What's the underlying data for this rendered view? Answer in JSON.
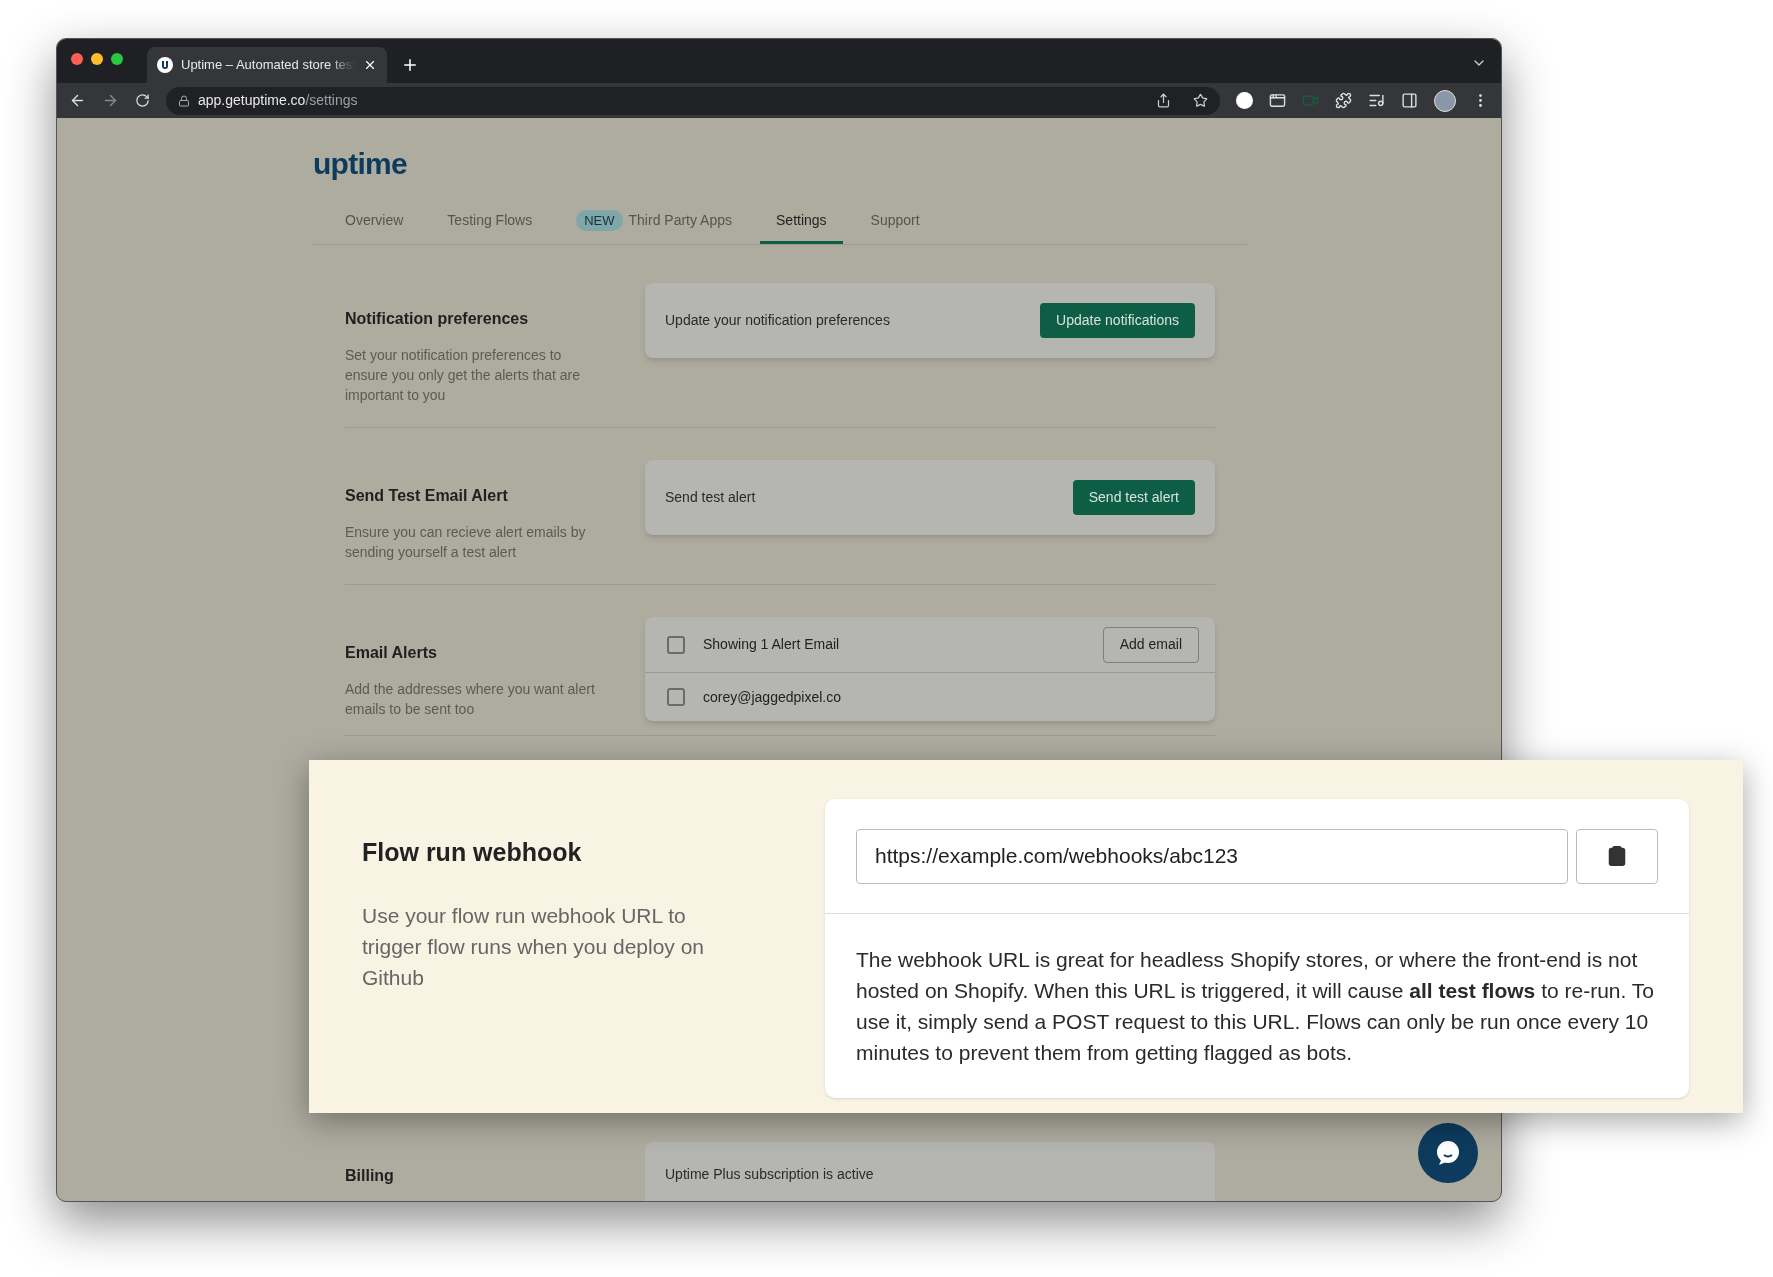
{
  "browser": {
    "tab_title": "Uptime – Automated store test",
    "url_host": "app.getuptime.co",
    "url_path": "/settings"
  },
  "app": {
    "logo": "uptime",
    "nav": [
      {
        "label": "Overview",
        "selected": false
      },
      {
        "label": "Testing Flows",
        "selected": false
      },
      {
        "label": "Third Party Apps",
        "badge": "NEW",
        "selected": false
      },
      {
        "label": "Settings",
        "selected": true
      },
      {
        "label": "Support",
        "selected": false
      }
    ],
    "sections": [
      {
        "kind": "action",
        "title": "Notification preferences",
        "description": "Set your notification preferences to ensure you only get the alerts that are important to you",
        "card_text": "Update your notification preferences",
        "button": "Update notifications"
      },
      {
        "kind": "action",
        "title": "Send Test Email Alert",
        "description": "Ensure you can recieve alert emails by sending yourself a test alert",
        "card_text": "Send test alert",
        "button": "Send test alert"
      },
      {
        "kind": "emails",
        "title": "Email Alerts",
        "description": "Add the addresses where you want alert emails to be sent too",
        "header": {
          "label": "Showing 1 Alert Email",
          "checked": false
        },
        "button": "Add email",
        "emails": [
          {
            "address": "corey@jaggedpixel.co",
            "checked": false
          }
        ]
      },
      {
        "kind": "hidden"
      },
      {
        "kind": "billing",
        "title": "Billing",
        "card_text": "Uptime Plus subscription is active"
      }
    ]
  },
  "webhook": {
    "title": "Flow run webhook",
    "description": "Use your flow run webhook URL to trigger flow runs when you deploy on Github",
    "url": "https://example.com/webhooks/abc123",
    "info": "The webhook URL is great for headless Shopify stores, or where the front-end is not hosted on Shopify. When this URL is triggered, it will cause **all test flows** to re-run. To use it, simply send a POST request to this URL. Flows can only be run once every 10 minutes to prevent them from getting flagged as bots."
  }
}
